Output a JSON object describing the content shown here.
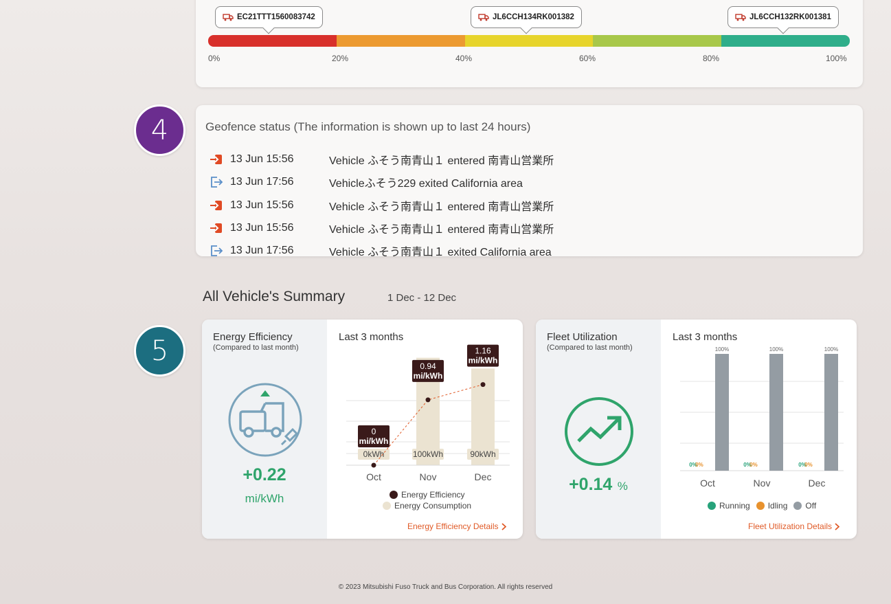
{
  "range_card": {
    "vins": [
      "EC21TTT1560083742",
      "JL6CCH134RK001382",
      "JL6CCH132RK001381"
    ],
    "segments": [
      "#d8302b",
      "#ec9a31",
      "#e7d42b",
      "#a8c84a",
      "#2fae8a"
    ],
    "labels": [
      "0%",
      "20%",
      "40%",
      "60%",
      "80%",
      "100%"
    ]
  },
  "badges": {
    "geofence": "4",
    "summary": "5"
  },
  "geofence": {
    "title": "Geofence status (The information is shown up to last 24 hours)",
    "events": [
      {
        "type": "entered",
        "time": "13 Jun 15:56",
        "text": "Vehicle ふそう南青山１ entered 南青山営業所"
      },
      {
        "type": "exited",
        "time": "13 Jun 17:56",
        "text": "Vehicleふそう229 exited California area"
      },
      {
        "type": "entered",
        "time": "13 Jun 15:56",
        "text": "Vehicle ふそう南青山１ entered 南青山営業所"
      },
      {
        "type": "entered",
        "time": "13 Jun 15:56",
        "text": "Vehicle ふそう南青山１ entered 南青山営業所"
      },
      {
        "type": "exited",
        "time": "13 Jun 17:56",
        "text": "Vehicle ふそう南青山１ exited California area"
      }
    ]
  },
  "summary": {
    "title": "All Vehicle's Summary",
    "date_range": "1 Dec - 12 Dec",
    "energy": {
      "title": "Energy Efficiency",
      "subtitle": "(Compared to last month)",
      "value": "+0.22",
      "unit": "mi/kWh",
      "chart_title": "Last 3 months",
      "legend_efficiency": "Energy Efficiency",
      "legend_consumption": "Energy Consumption",
      "details": "Energy Efficiency Details"
    },
    "fleet": {
      "title": "Fleet Utilization",
      "subtitle": "(Compared to last month)",
      "value": "+0.14",
      "unit": "%",
      "chart_title": "Last 3 months",
      "legend_running": "Running",
      "legend_idling": "Idling",
      "legend_off": "Off",
      "details": "Fleet Utilization Details"
    }
  },
  "chart_data": [
    {
      "type": "bar",
      "categories": [
        "Oct",
        "Nov",
        "Dec"
      ],
      "series": [
        {
          "name": "Energy Consumption",
          "values": [
            0,
            100,
            90
          ],
          "labels": [
            "0kWh",
            "100kWh",
            "90kWh"
          ]
        },
        {
          "name": "Energy Efficiency",
          "values": [
            0,
            0.94,
            1.16
          ],
          "labels": [
            "0\nmi/kWh",
            "0.94\nmi/kWh",
            "1.16\nmi/kWh"
          ]
        }
      ],
      "title": "Last 3 months"
    },
    {
      "type": "bar",
      "categories": [
        "Oct",
        "Nov",
        "Dec"
      ],
      "series": [
        {
          "name": "Running",
          "values": [
            0,
            0,
            0
          ],
          "labels": [
            "0%",
            "0%",
            "0%"
          ],
          "color": "#27a27a"
        },
        {
          "name": "Idling",
          "values": [
            0,
            0,
            0
          ],
          "labels": [
            "0%",
            "0%",
            "0%"
          ],
          "color": "#e8922e"
        },
        {
          "name": "Off",
          "values": [
            100,
            100,
            100
          ],
          "labels": [
            "100%",
            "100%",
            "100%"
          ],
          "color": "#949ca3"
        }
      ],
      "ylim": [
        0,
        100
      ],
      "title": "Last 3 months"
    }
  ],
  "footer": "© 2023 Mitsubishi Fuso Truck and Bus Corporation. All rights reserved"
}
